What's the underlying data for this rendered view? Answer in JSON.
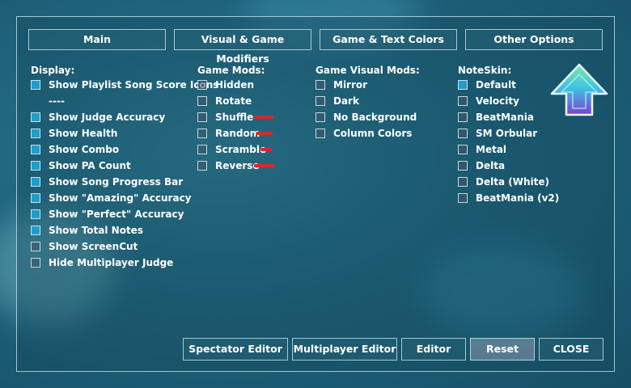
{
  "tabs": [
    "Main",
    "Visual & Game Modifiers",
    "Game & Text Colors",
    "Other Options"
  ],
  "display": {
    "title": "Display:",
    "items": [
      {
        "label": "Show Playlist Song Score Icons",
        "checked": true
      },
      {
        "label": "----",
        "separator": true
      },
      {
        "label": "Show Judge Accuracy",
        "checked": true
      },
      {
        "label": "Show Health",
        "checked": true
      },
      {
        "label": "Show Combo",
        "checked": true
      },
      {
        "label": "Show PA Count",
        "checked": true
      },
      {
        "label": "Show Song Progress Bar",
        "checked": true
      },
      {
        "label": "Show \"Amazing\" Accuracy",
        "checked": true
      },
      {
        "label": "Show \"Perfect\" Accuracy",
        "checked": true
      },
      {
        "label": "Show Total Notes",
        "checked": true
      },
      {
        "label": "Show ScreenCut",
        "checked": false
      },
      {
        "label": "Hide Multiplayer Judge",
        "checked": false
      }
    ]
  },
  "game_mods": {
    "title": "Game Mods:",
    "items": [
      {
        "label": "Hidden",
        "checked": false
      },
      {
        "label": "Rotate",
        "checked": false
      },
      {
        "label": "Shuffle",
        "checked": false,
        "flag": true
      },
      {
        "label": "Random",
        "checked": false,
        "flag": true
      },
      {
        "label": "Scramble",
        "checked": false,
        "flag": true
      },
      {
        "label": "Reverse",
        "checked": false,
        "flag": true
      }
    ]
  },
  "visual_mods": {
    "title": "Game Visual Mods:",
    "items": [
      {
        "label": "Mirror",
        "checked": false
      },
      {
        "label": "Dark",
        "checked": false
      },
      {
        "label": "No Background",
        "checked": false
      },
      {
        "label": "Column Colors",
        "checked": false
      }
    ]
  },
  "noteskin": {
    "title": "NoteSkin:",
    "items": [
      {
        "label": "Default",
        "checked": true
      },
      {
        "label": "Velocity",
        "checked": false
      },
      {
        "label": "BeatMania",
        "checked": false
      },
      {
        "label": "SM Orbular",
        "checked": false
      },
      {
        "label": "Metal",
        "checked": false
      },
      {
        "label": "Delta",
        "checked": false
      },
      {
        "label": "Delta (White)",
        "checked": false
      },
      {
        "label": "BeatMania (v2)",
        "checked": false
      }
    ]
  },
  "buttons": {
    "spectator": "Spectator Editor",
    "multiplayer": "Multiplayer Editor",
    "editor": "Editor",
    "reset": "Reset",
    "close": "CLOSE"
  },
  "colors": {
    "checked": "#1f9ec9",
    "flag": "#d42a2a",
    "border": "#d2ebf5"
  }
}
